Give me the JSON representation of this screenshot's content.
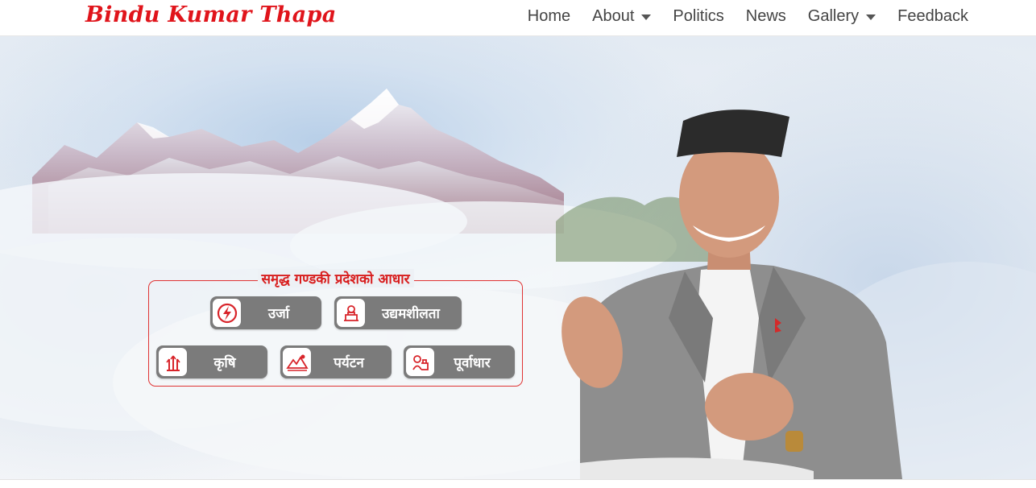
{
  "brand": {
    "name": "Bindu Kumar Thapa"
  },
  "nav": {
    "items": [
      {
        "label": "Home",
        "dropdown": false
      },
      {
        "label": "About",
        "dropdown": true
      },
      {
        "label": "Politics",
        "dropdown": false
      },
      {
        "label": "News",
        "dropdown": false
      },
      {
        "label": "Gallery",
        "dropdown": true
      },
      {
        "label": "Feedback",
        "dropdown": false
      }
    ]
  },
  "hero": {
    "tagline": "समृद्ध गण्डकी प्रदेशको आधार",
    "pillars": [
      {
        "label": "उर्जा",
        "icon": "energy-icon"
      },
      {
        "label": "उद्यमशीलता",
        "icon": "entrepreneurship-icon"
      },
      {
        "label": "कृषि",
        "icon": "agriculture-icon"
      },
      {
        "label": "पर्यटन",
        "icon": "tourism-icon"
      },
      {
        "label": "पूर्वाधार",
        "icon": "infrastructure-icon"
      }
    ]
  },
  "colors": {
    "brand_red": "#e0141b",
    "pill_gray": "#7b7b7b",
    "nav_text": "#444444"
  }
}
